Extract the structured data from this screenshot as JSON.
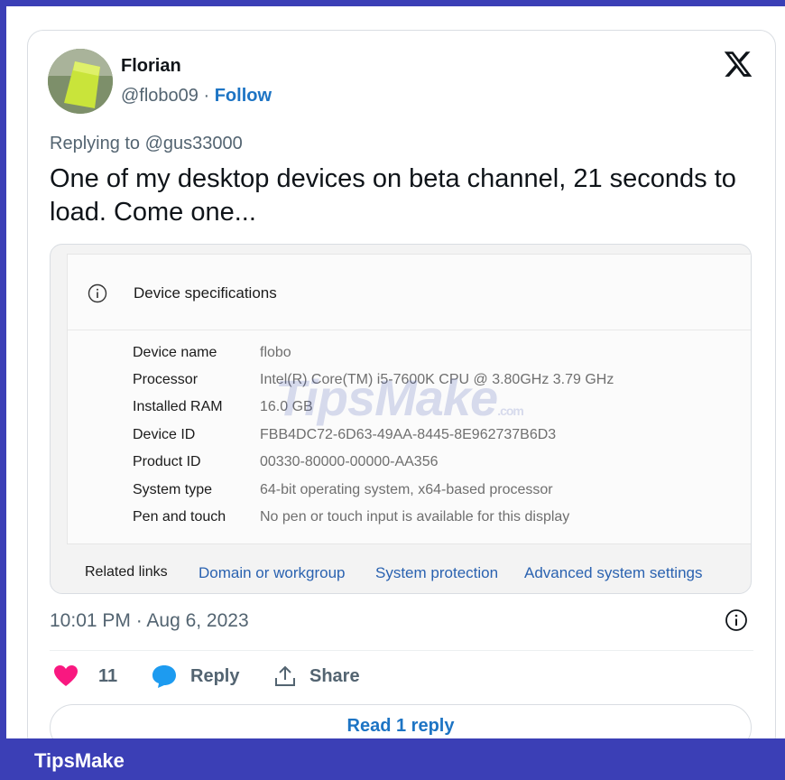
{
  "author": {
    "name": "Florian",
    "handle": "@flobo09",
    "separator": "·",
    "follow_label": "Follow"
  },
  "reply_to": "Replying to @gus33000",
  "text": "One of my desktop devices on beta channel, 21 seconds to load. Come one...",
  "screenshot": {
    "title": "Device specifications",
    "specs": [
      {
        "label": "Device name",
        "value": "flobo"
      },
      {
        "label": "Processor",
        "value": "Intel(R) Core(TM) i5-7600K CPU @ 3.80GHz   3.79 GHz"
      },
      {
        "label": "Installed RAM",
        "value": "16.0 GB"
      },
      {
        "label": "Device ID",
        "value": "FBB4DC72-6D63-49AA-8445-8E962737B6D3"
      },
      {
        "label": "Product ID",
        "value": "00330-80000-00000-AA356"
      },
      {
        "label": "System type",
        "value": "64-bit operating system, x64-based processor"
      },
      {
        "label": "Pen and touch",
        "value": "No pen or touch input is available for this display"
      }
    ],
    "related_label": "Related links",
    "related_links": [
      "Domain or workgroup",
      "System protection",
      "Advanced system settings"
    ],
    "watermark": "TipsMake",
    "watermark_suffix": ".com"
  },
  "timestamp": "10:01 PM · Aug 6, 2023",
  "actions": {
    "like_count": "11",
    "reply_label": "Reply",
    "share_label": "Share"
  },
  "read_replies_label": "Read 1 reply",
  "footer_brand": "TipsMake",
  "colors": {
    "frame": "#3b3fb6",
    "link_blue": "#1d74c4",
    "heart": "#f91880",
    "reply_bubble": "#1d9bf0"
  }
}
